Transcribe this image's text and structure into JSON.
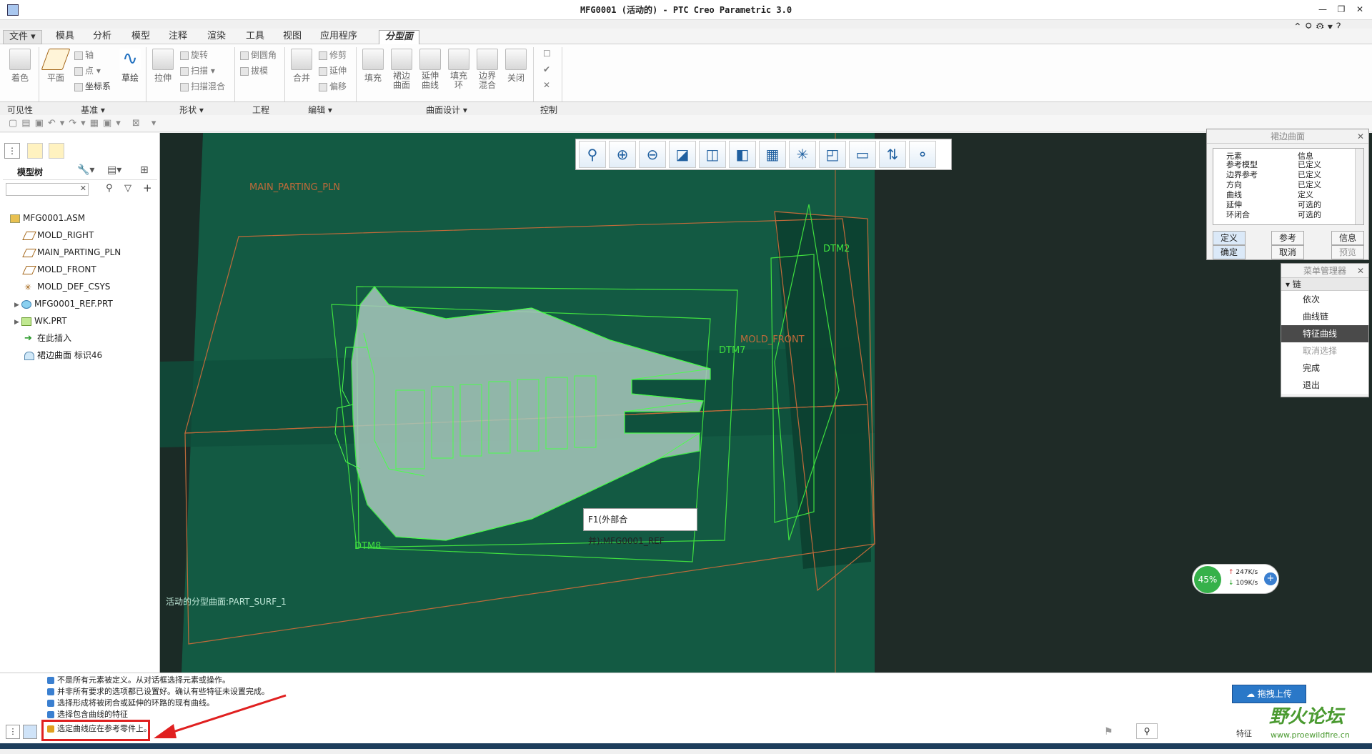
{
  "window": {
    "title": "MFG0001 (活动的) - PTC Creo Parametric 3.0"
  },
  "ribbon_tabs": [
    "文件",
    "模具",
    "分析",
    "模型",
    "注释",
    "渲染",
    "工具",
    "视图",
    "应用程序",
    "分型面"
  ],
  "ribbon": {
    "visibility": {
      "coloring": "着色"
    },
    "datum": {
      "plane": "平面",
      "axis": "轴",
      "point": "点",
      "csys": "坐标系",
      "sketch": "草绘"
    },
    "shape": {
      "extrude": "拉伸",
      "revolve": "旋转",
      "sweep": "扫描",
      "swept_blend": "扫描混合"
    },
    "engineering": {
      "round": "倒圆角",
      "draft": "拔模"
    },
    "editing": {
      "merge": "合并",
      "trim": "修剪",
      "extend": "延伸",
      "offset": "偏移"
    },
    "surface_design": {
      "fill": "填充",
      "skirt_surface": "裙边曲面",
      "extend_curve": "延伸曲线",
      "fill_loop": "填充环",
      "boundary_blend": "边界混合",
      "close": "关闭"
    },
    "groups": [
      "可见性",
      "基准",
      "形状",
      "工程",
      "编辑",
      "曲面设计",
      "控制"
    ]
  },
  "model_tree": {
    "header": "模型树",
    "items": [
      {
        "label": "MFG0001.ASM",
        "icon": "assembly-icon"
      },
      {
        "label": "MOLD_RIGHT",
        "icon": "datum-plane-icon"
      },
      {
        "label": "MAIN_PARTING_PLN",
        "icon": "datum-plane-icon"
      },
      {
        "label": "MOLD_FRONT",
        "icon": "datum-plane-icon"
      },
      {
        "label": "MOLD_DEF_CSYS",
        "icon": "csys-icon"
      },
      {
        "label": "MFG0001_REF.PRT",
        "icon": "part-icon"
      },
      {
        "label": "WK.PRT",
        "icon": "part-icon"
      },
      {
        "label": "在此插入",
        "icon": "insert-arrow-icon"
      },
      {
        "label": "裙边曲面 标识46",
        "icon": "skirt-surface-icon"
      }
    ]
  },
  "viewport": {
    "labels": {
      "main_parting": "MAIN_PARTING_PLN",
      "dtm2": "DTM2",
      "mold_front": "MOLD_FRONT",
      "dtm7": "DTM7",
      "dtm8": "DTM8"
    },
    "status_text": "活动的分型曲面:PART_SURF_1",
    "tooltip": "F1(外部合并):MFG0001_REF"
  },
  "skirt_dialog": {
    "title": "裙边曲面",
    "col_element": "元素",
    "col_info": "信息",
    "rows": [
      {
        "element": "参考模型",
        "info": "已定义"
      },
      {
        "element": "边界参考",
        "info": "已定义"
      },
      {
        "element": "方向",
        "info": "已定义"
      },
      {
        "element": "曲线",
        "info": "定义"
      },
      {
        "element": "延伸",
        "info": "可选的"
      },
      {
        "element": "环闭合",
        "info": "可选的"
      }
    ],
    "buttons": {
      "define": "定义",
      "reference": "参考",
      "info": "信息",
      "ok": "确定",
      "cancel": "取消",
      "preview": "预览"
    }
  },
  "menu_manager": {
    "title": "菜单管理器",
    "section": "链",
    "items": [
      "依次",
      "曲线链",
      "特征曲线",
      "取消选择",
      "完成",
      "退出"
    ],
    "selected_index": 2
  },
  "network_widget": {
    "percent": "45%",
    "up": "247K/s",
    "down": "109K/s"
  },
  "messages": [
    "不是所有元素被定义。从对话框选择元素或操作。",
    "并非所有要求的选项都已设置好。确认有些特征未设置完成。",
    "选择形成将被闭合或延伸的环路的现有曲线。",
    "选择包含曲线的特征",
    "选定曲线应在参考零件上。"
  ],
  "upload_button": "拖拽上传",
  "watermark": {
    "text": "野火论坛",
    "url": "www.proewildfire.cn"
  },
  "status_filter": "特征"
}
